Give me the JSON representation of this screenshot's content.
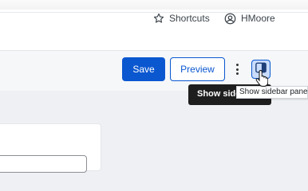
{
  "header": {
    "shortcuts_label": "Shortcuts",
    "user_name": "HMoore"
  },
  "toolbar": {
    "save_label": "Save",
    "preview_label": "Preview",
    "more_icon": "vertical-ellipsis-icon",
    "sidebar_icon": "sidebar-panel-icon"
  },
  "tooltips": {
    "dark_text": "Show sidebar panel",
    "light_text": "Show sidebar panel"
  },
  "colors": {
    "accent": "#0b57d0",
    "toggle_active_bg": "#c9dcfb",
    "tooltip_dark": "#1e1e1e"
  }
}
